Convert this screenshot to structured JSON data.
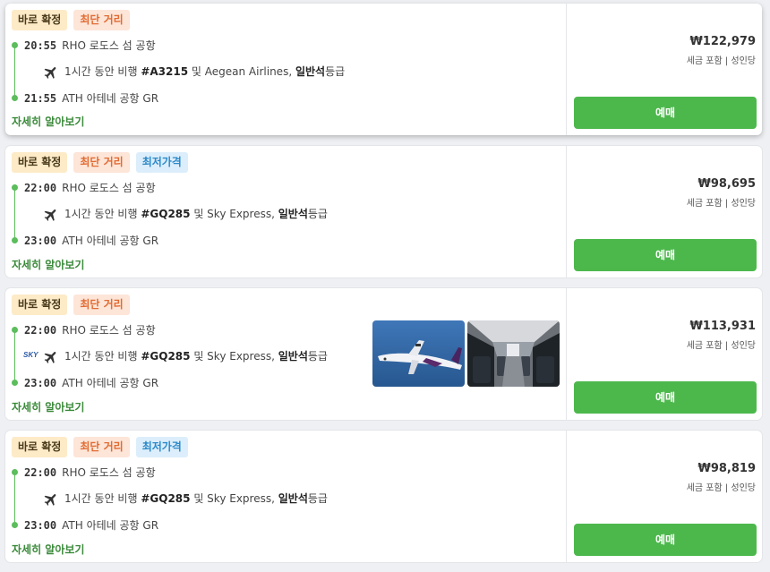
{
  "badges": {
    "confirm": "바로 확정",
    "short": "최단 거리",
    "cheapest": "최저가격"
  },
  "more_label": "자세히 알아보기",
  "book_label": "예매",
  "price_note": "세금 포함 | 성인당",
  "flights": [
    {
      "dep_time": "20:55",
      "dep_place": "RHO 로도스 섬 공항",
      "arr_time": "21:55",
      "arr_place": "ATH 아테네 공항 GR",
      "duration_text": "1시간 동안 비행",
      "flight_no": "#A3215",
      "airline_text": "및 Aegean Airlines,",
      "class_text": "일반석",
      "grade_suffix": "등급",
      "price": "₩122,979",
      "tags": [
        "confirm",
        "short"
      ]
    },
    {
      "dep_time": "22:00",
      "dep_place": "RHO 로도스 섬 공항",
      "arr_time": "23:00",
      "arr_place": "ATH 아테네 공항 GR",
      "duration_text": "1시간 동안 비행",
      "flight_no": "#GQ285",
      "airline_text": "및 Sky Express,",
      "class_text": "일반석",
      "grade_suffix": "등급",
      "price": "₩98,695",
      "tags": [
        "confirm",
        "short",
        "cheapest"
      ]
    },
    {
      "dep_time": "22:00",
      "dep_place": "RHO 로도스 섬 공항",
      "arr_time": "23:00",
      "arr_place": "ATH 아테네 공항 GR",
      "duration_text": "1시간 동안 비행",
      "flight_no": "#GQ285",
      "airline_text": "및 Sky Express,",
      "class_text": "일반석",
      "grade_suffix": "등급",
      "price": "₩113,931",
      "logo": "SKY",
      "tags": [
        "confirm",
        "short"
      ]
    },
    {
      "dep_time": "22:00",
      "dep_place": "RHO 로도스 섬 공항",
      "arr_time": "23:00",
      "arr_place": "ATH 아테네 공항 GR",
      "duration_text": "1시간 동안 비행",
      "flight_no": "#GQ285",
      "airline_text": "및 Sky Express,",
      "class_text": "일반석",
      "grade_suffix": "등급",
      "price": "₩98,819",
      "tags": [
        "confirm",
        "short",
        "cheapest"
      ]
    }
  ],
  "colors": {
    "accent_green": "#4cb84c",
    "badge_confirm": "#fdebc8",
    "badge_short": "#fde5d8",
    "badge_cheap": "#dceefb"
  }
}
